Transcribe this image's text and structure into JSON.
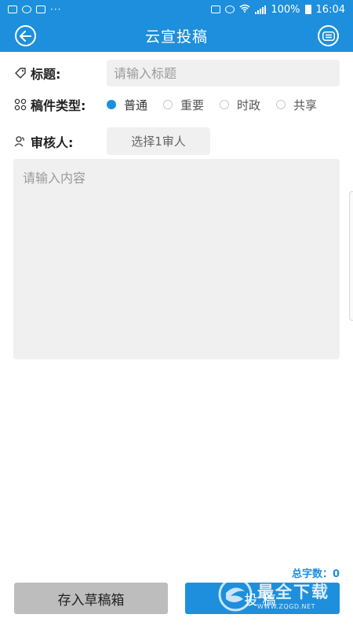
{
  "status_bar": {
    "battery": "100%",
    "time": "16:04",
    "dots": "···"
  },
  "header": {
    "title": "云宣投稿",
    "back_icon": "back-arrow-circle-icon",
    "menu_icon": "chat-menu-circle-icon"
  },
  "form": {
    "title_label": "标题:",
    "title_placeholder": "请输入标题",
    "type_label": "稿件类型:",
    "types": [
      {
        "label": "普通",
        "checked": true
      },
      {
        "label": "重要",
        "checked": false
      },
      {
        "label": "时政",
        "checked": false
      },
      {
        "label": "共享",
        "checked": false
      }
    ],
    "reviewer_label": "审核人:",
    "reviewer_button": "选择1审人",
    "content_placeholder": "请输入内容"
  },
  "footer": {
    "word_count": "总字数：0",
    "draft_button": "存入草稿箱",
    "submit_button": "投稿"
  },
  "watermark": {
    "big": "最全下载",
    "small": "WWW.ZQGD.NET"
  },
  "colors": {
    "accent": "#1e8fdc",
    "input_bg": "#f0f0f0",
    "draft_bg": "#bdbdbd"
  }
}
